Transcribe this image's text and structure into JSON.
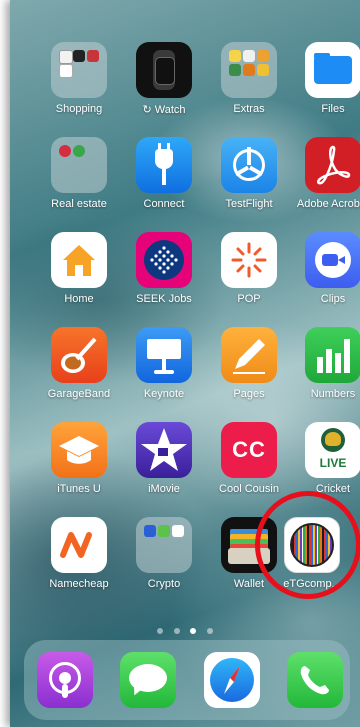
{
  "apps": [
    {
      "id": "shopping",
      "label": "Shopping",
      "icon": "shopping-folder-icon"
    },
    {
      "id": "watch",
      "label": "Watch",
      "icon": "watch-icon"
    },
    {
      "id": "extras",
      "label": "Extras",
      "icon": "extras-folder-icon"
    },
    {
      "id": "files",
      "label": "Files",
      "icon": "files-icon"
    },
    {
      "id": "real-estate",
      "label": "Real estate",
      "icon": "real-estate-folder-icon"
    },
    {
      "id": "connect",
      "label": "Connect",
      "icon": "connect-plug-icon"
    },
    {
      "id": "testflight",
      "label": "TestFlight",
      "icon": "testflight-propeller-icon"
    },
    {
      "id": "adobe-acrobat",
      "label": "Adobe Acrobat",
      "icon": "acrobat-icon"
    },
    {
      "id": "home",
      "label": "Home",
      "icon": "home-icon"
    },
    {
      "id": "seek-jobs",
      "label": "SEEK Jobs",
      "icon": "seek-icon"
    },
    {
      "id": "pop",
      "label": "POP",
      "icon": "pop-sun-icon"
    },
    {
      "id": "clips",
      "label": "Clips",
      "icon": "clips-camera-icon"
    },
    {
      "id": "garageband",
      "label": "GarageBand",
      "icon": "guitar-icon"
    },
    {
      "id": "keynote",
      "label": "Keynote",
      "icon": "keynote-podium-icon"
    },
    {
      "id": "pages",
      "label": "Pages",
      "icon": "pages-pen-icon"
    },
    {
      "id": "numbers",
      "label": "Numbers",
      "icon": "numbers-bars-icon"
    },
    {
      "id": "itunes-u",
      "label": "iTunes U",
      "icon": "graduation-cap-icon"
    },
    {
      "id": "imovie",
      "label": "iMovie",
      "icon": "imovie-star-icon"
    },
    {
      "id": "cool-cousin",
      "label": "Cool Cousin",
      "icon": "cool-cousin-cc-icon",
      "text": "CC"
    },
    {
      "id": "cricket",
      "label": "Cricket",
      "icon": "cricket-australia-icon",
      "text": "LIVE"
    },
    {
      "id": "namecheap",
      "label": "Namecheap",
      "icon": "namecheap-n-icon"
    },
    {
      "id": "crypto",
      "label": "Crypto",
      "icon": "crypto-folder-icon"
    },
    {
      "id": "wallet",
      "label": "Wallet",
      "icon": "wallet-icon"
    },
    {
      "id": "etgcomp",
      "label": "eTGcomp...",
      "icon": "etg-stripes-icon"
    }
  ],
  "dock": [
    {
      "id": "podcasts",
      "icon": "podcasts-icon"
    },
    {
      "id": "messages",
      "icon": "messages-bubble-icon"
    },
    {
      "id": "safari",
      "icon": "safari-compass-icon"
    },
    {
      "id": "phone",
      "icon": "phone-handset-icon"
    }
  ],
  "page_dots": {
    "count": 4,
    "active_index": 2
  },
  "colors": {
    "highlight_ring": "#e5101c"
  }
}
